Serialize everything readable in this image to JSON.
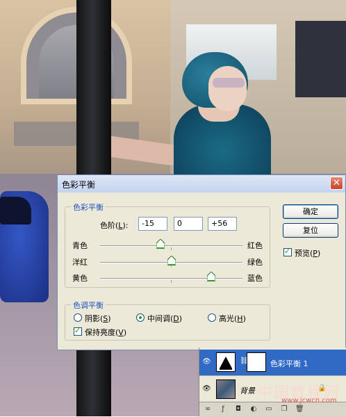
{
  "dialog": {
    "title": "色彩平衡",
    "color_balance_group": {
      "legend": "色彩平衡",
      "levels_label": "色阶(",
      "levels_label_mnemonic": "L",
      "levels_label_end": "):",
      "levels": [
        "-15",
        "0",
        "+56"
      ],
      "sliders": [
        {
          "left": "青色",
          "right": "红色",
          "value": -15
        },
        {
          "left": "洋红",
          "right": "绿色",
          "value": 0
        },
        {
          "left": "黄色",
          "right": "蓝色",
          "value": 56
        }
      ]
    },
    "tone_balance_group": {
      "legend": "色调平衡",
      "shadows": "阴影(",
      "shadows_key": "S",
      "midtones": "中间调(",
      "midtones_key": "D",
      "highlights": "高光(",
      "highlights_key": "H",
      "close_paren": ")",
      "selected": "midtones",
      "preserve_luminosity": "保持亮度(",
      "preserve_luminosity_key": "V",
      "preserve_checked": true
    },
    "buttons": {
      "ok": "确定",
      "reset": "复位"
    },
    "preview": {
      "label": "预览(",
      "key": "P",
      "close": ")",
      "checked": true
    },
    "close_glyph": "✕"
  },
  "layers_panel": {
    "layers": [
      {
        "name": "色彩平衡 1",
        "selected": true,
        "visible": true
      },
      {
        "name": "背景",
        "selected": false,
        "visible": true,
        "locked": true
      }
    ]
  },
  "watermark": {
    "text": "中国教程网",
    "url": "www.jcwcn.com"
  },
  "colors": {
    "accent_title": "#1f4fbf",
    "selection": "#316ac5",
    "close": "#c8422a"
  }
}
